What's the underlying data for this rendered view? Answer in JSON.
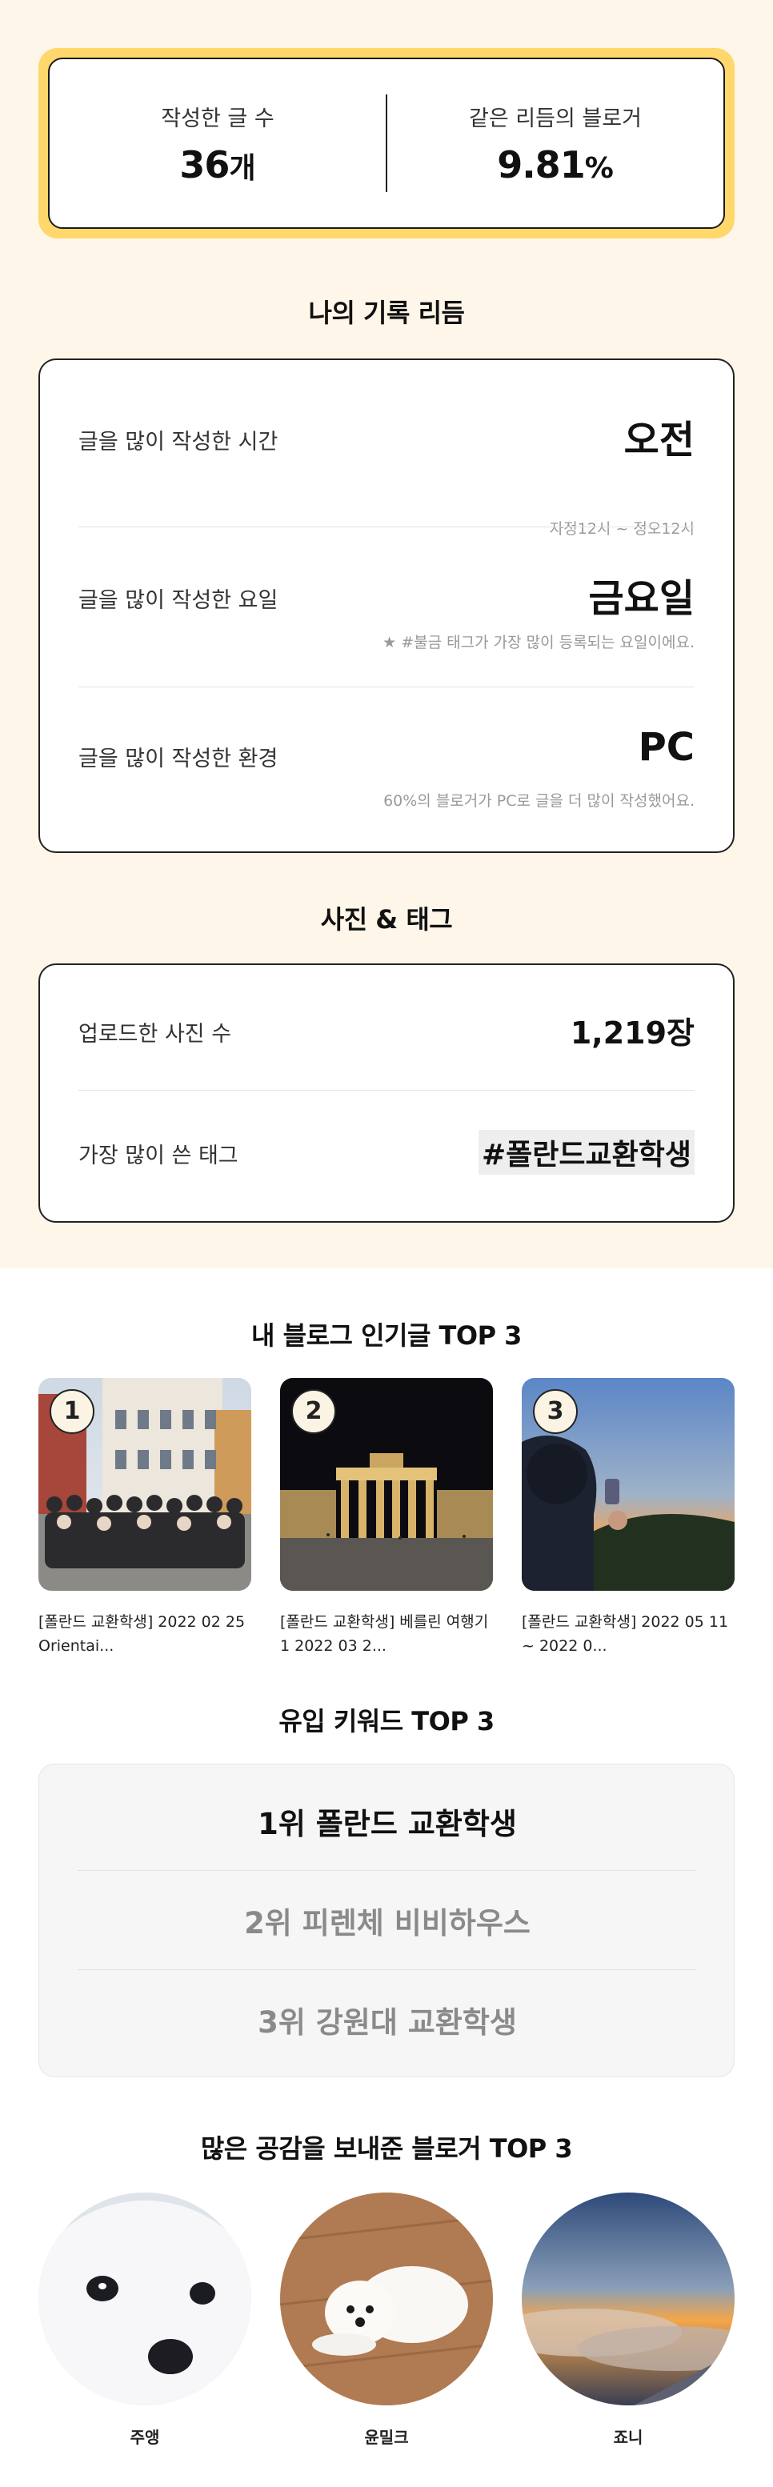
{
  "stats": {
    "posts_label": "작성한 글 수",
    "posts_value": "36",
    "posts_unit": "개",
    "rhythm_label": "같은 리듬의 블로거",
    "rhythm_value": "9.81",
    "rhythm_unit": "%"
  },
  "rhythm_section": {
    "title": "나의 기록 리듬",
    "rows": [
      {
        "label": "글을 많이 작성한 시간",
        "value": "오전",
        "sub": "자정12시 ~ 정오12시"
      },
      {
        "label": "글을 많이 작성한 요일",
        "value": "금요일",
        "sub": "★ #불금 태그가 가장 많이 등록되는 요일이에요."
      },
      {
        "label": "글을 많이 작성한 환경",
        "value": "PC",
        "sub": "60%의 블로거가 PC로 글을 더 많이 작성했어요."
      }
    ]
  },
  "photo_tag_section": {
    "title": "사진 & 태그",
    "photos_label": "업로드한 사진 수",
    "photos_value": "1,219장",
    "tag_label": "가장 많이 쓴 태그",
    "tag_value": "#폴란드교환학생"
  },
  "popular_posts": {
    "title": "내 블로그 인기글 TOP 3",
    "items": [
      {
        "rank": "1",
        "caption": "[폴란드 교환학생] 2022 02 25 Orientai..."
      },
      {
        "rank": "2",
        "caption": "[폴란드 교환학생] 베를린 여행기 1 2022 03 2..."
      },
      {
        "rank": "3",
        "caption": "[폴란드 교환학생] 2022 05 11 ~ 2022 0..."
      }
    ]
  },
  "keywords": {
    "title": "유입 키워드 TOP 3",
    "items": [
      {
        "text": "1위 폴란드 교환학생",
        "color": "#111111"
      },
      {
        "text": "2위 피렌체 비비하우스",
        "color": "#8a8a8a"
      },
      {
        "text": "3위 강원대 교환학생",
        "color": "#8a8a8a"
      }
    ]
  },
  "bloggers": {
    "title": "많은 공감을 보내준 블로거 TOP 3",
    "items": [
      {
        "name": "주앵"
      },
      {
        "name": "윤밀크"
      },
      {
        "name": "죠니"
      }
    ]
  },
  "colors": {
    "cream_bg": "#fdf6e9",
    "accent_yellow": "#ffd76a"
  }
}
